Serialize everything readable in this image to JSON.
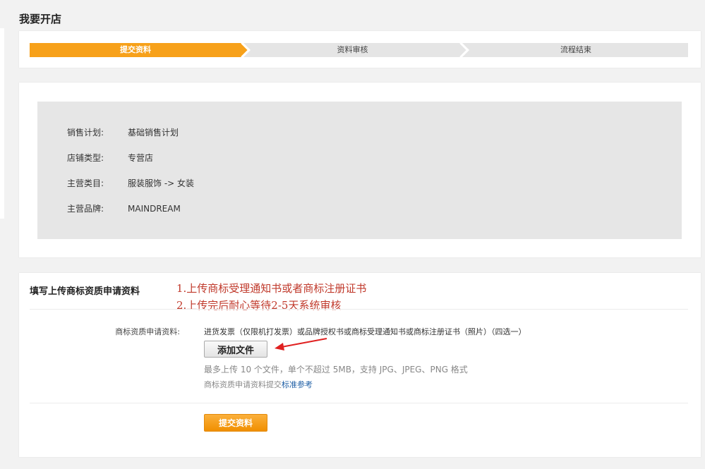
{
  "page": {
    "title": "我要开店"
  },
  "steps": [
    {
      "label": "提交资料",
      "active": true
    },
    {
      "label": "资料审核",
      "active": false
    },
    {
      "label": "流程结束",
      "active": false
    }
  ],
  "colors": {
    "accent": "#f7a11a",
    "step_inactive": "#e5e5e5",
    "note_red": "#c0392b",
    "link": "#1f5fa5"
  },
  "info": {
    "rows": [
      {
        "key": "销售计划:",
        "value": "基础销售计划"
      },
      {
        "key": "店铺类型:",
        "value": "专营店"
      },
      {
        "key": "主营类目:",
        "value": "服装服饰 -> 女装"
      },
      {
        "key": "主营品牌:",
        "value": "MAINDREAM"
      }
    ]
  },
  "form": {
    "heading": "填写上传商标资质申请资料",
    "notes": [
      "1.上传商标受理通知书或者商标注册证书",
      "2.上传完后耐心等待2-5天系统审核"
    ],
    "field_label": "商标资质申请资料:",
    "field_hint": "进货发票（仅限机打发票）或品牌授权书或商标受理通知书或商标注册证书（照片）（四选一）",
    "add_file_label": "添加文件",
    "limit_text": "最多上传 10 个文件，单个不超过 5MB，支持 JPG、JPEG、PNG 格式",
    "ref_prefix": "商标资质申请资料提交",
    "ref_link": "标准参考",
    "submit_label": "提交资料"
  }
}
